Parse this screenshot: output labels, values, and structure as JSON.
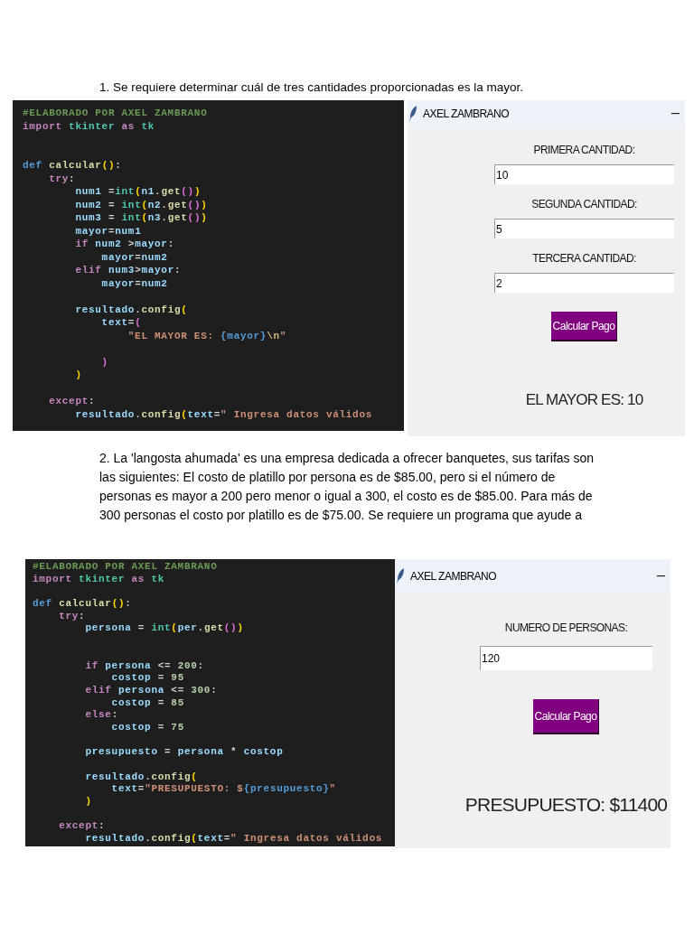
{
  "exercises": [
    {
      "statement": "1. Se requiere determinar cuál de tres cantidades proporcionadas es la mayor.",
      "code": {
        "lines": [
          {
            "kind": "code",
            "segments": [
              {
                "text": "#ELABORADO POR AXEL ZAMBRANO",
                "kind": "comment"
              }
            ]
          },
          {
            "kind": "code",
            "segments": [
              {
                "text": "import",
                "kind": "keyword"
              },
              {
                "text": " tkinter",
                "kind": "module"
              },
              {
                "text": " as ",
                "kind": "keyword"
              },
              {
                "text": "tk",
                "kind": "module"
              }
            ]
          },
          {
            "kind": "blank"
          },
          {
            "kind": "blank"
          },
          {
            "kind": "code",
            "segments": [
              {
                "text": "def ",
                "kind": "storage"
              },
              {
                "text": "calcular",
                "kind": "func"
              },
              {
                "text": "()",
                "kind": "bracket1"
              },
              {
                "text": ":",
                "kind": "op"
              }
            ]
          },
          {
            "kind": "code",
            "segments": [
              {
                "text": "    try",
                "kind": "keyword"
              },
              {
                "text": ":",
                "kind": "op"
              }
            ]
          },
          {
            "kind": "code",
            "segments": [
              {
                "text": "        num1",
                "kind": "var"
              },
              {
                "text": " =",
                "kind": "op"
              },
              {
                "text": "int",
                "kind": "builtin"
              },
              {
                "text": "(",
                "kind": "bracket1"
              },
              {
                "text": "n1",
                "kind": "var"
              },
              {
                "text": ".",
                "kind": "op"
              },
              {
                "text": "get",
                "kind": "func"
              },
              {
                "text": "()",
                "kind": "bracket2"
              },
              {
                "text": ")",
                "kind": "bracket1"
              }
            ]
          },
          {
            "kind": "code",
            "segments": [
              {
                "text": "        num2",
                "kind": "var"
              },
              {
                "text": " = ",
                "kind": "op"
              },
              {
                "text": "int",
                "kind": "builtin"
              },
              {
                "text": "(",
                "kind": "bracket1"
              },
              {
                "text": "n2",
                "kind": "var"
              },
              {
                "text": ".",
                "kind": "op"
              },
              {
                "text": "get",
                "kind": "func"
              },
              {
                "text": "()",
                "kind": "bracket2"
              },
              {
                "text": ")",
                "kind": "bracket1"
              }
            ]
          },
          {
            "kind": "code",
            "segments": [
              {
                "text": "        num3",
                "kind": "var"
              },
              {
                "text": " = ",
                "kind": "op"
              },
              {
                "text": "int",
                "kind": "builtin"
              },
              {
                "text": "(",
                "kind": "bracket1"
              },
              {
                "text": "n3",
                "kind": "var"
              },
              {
                "text": ".",
                "kind": "op"
              },
              {
                "text": "get",
                "kind": "func"
              },
              {
                "text": "()",
                "kind": "bracket2"
              },
              {
                "text": ")",
                "kind": "bracket1"
              }
            ]
          },
          {
            "kind": "code",
            "segments": [
              {
                "text": "        mayor",
                "kind": "var"
              },
              {
                "text": "=",
                "kind": "op"
              },
              {
                "text": "num1",
                "kind": "var"
              }
            ]
          },
          {
            "kind": "code",
            "segments": [
              {
                "text": "        if ",
                "kind": "keyword"
              },
              {
                "text": "num2",
                "kind": "var"
              },
              {
                "text": " >",
                "kind": "op"
              },
              {
                "text": "mayor",
                "kind": "var"
              },
              {
                "text": ":",
                "kind": "op"
              }
            ]
          },
          {
            "kind": "code",
            "segments": [
              {
                "text": "            mayor",
                "kind": "var"
              },
              {
                "text": "=",
                "kind": "op"
              },
              {
                "text": "num2",
                "kind": "var"
              }
            ]
          },
          {
            "kind": "code",
            "segments": [
              {
                "text": "        elif ",
                "kind": "keyword"
              },
              {
                "text": "num3",
                "kind": "var"
              },
              {
                "text": ">",
                "kind": "op"
              },
              {
                "text": "mayor",
                "kind": "var"
              },
              {
                "text": ":",
                "kind": "op"
              }
            ]
          },
          {
            "kind": "code",
            "segments": [
              {
                "text": "            mayor",
                "kind": "var"
              },
              {
                "text": "=",
                "kind": "op"
              },
              {
                "text": "num2",
                "kind": "var"
              }
            ]
          },
          {
            "kind": "blank"
          },
          {
            "kind": "code",
            "segments": [
              {
                "text": "        resultado",
                "kind": "var"
              },
              {
                "text": ".",
                "kind": "op"
              },
              {
                "text": "config",
                "kind": "func"
              },
              {
                "text": "(",
                "kind": "bracket1"
              }
            ]
          },
          {
            "kind": "code",
            "segments": [
              {
                "text": "            text",
                "kind": "var"
              },
              {
                "text": "=",
                "kind": "op"
              },
              {
                "text": "(",
                "kind": "bracket2"
              }
            ]
          },
          {
            "kind": "code",
            "segments": [
              {
                "text": "                \"EL MAYOR ES: ",
                "kind": "string"
              },
              {
                "text": "{mayor}",
                "kind": "format"
              },
              {
                "text": "\\n",
                "kind": "escape"
              },
              {
                "text": "\"",
                "kind": "string"
              }
            ]
          },
          {
            "kind": "blank"
          },
          {
            "kind": "code",
            "segments": [
              {
                "text": "            )",
                "kind": "bracket2"
              }
            ]
          },
          {
            "kind": "code",
            "segments": [
              {
                "text": "        )",
                "kind": "bracket1"
              }
            ]
          },
          {
            "kind": "blank"
          },
          {
            "kind": "code",
            "segments": [
              {
                "text": "    except",
                "kind": "keyword"
              },
              {
                "text": ":",
                "kind": "op"
              }
            ]
          },
          {
            "kind": "code",
            "segments": [
              {
                "text": "        resultado",
                "kind": "var"
              },
              {
                "text": ".",
                "kind": "op"
              },
              {
                "text": "config",
                "kind": "func"
              },
              {
                "text": "(",
                "kind": "bracket1"
              },
              {
                "text": "text",
                "kind": "var"
              },
              {
                "text": "=",
                "kind": "op"
              },
              {
                "text": "\" Ingresa datos válidos",
                "kind": "string"
              }
            ]
          }
        ]
      },
      "app": {
        "title": "AXEL ZAMBRANO",
        "fields": [
          {
            "label": "PRIMERA CANTIDAD:",
            "value": "10"
          },
          {
            "label": "SEGUNDA CANTIDAD:",
            "value": "5"
          },
          {
            "label": "TERCERA CANTIDAD:",
            "value": "2"
          }
        ],
        "button": "Calcular Pago",
        "result": "EL MAYOR ES: 10"
      }
    },
    {
      "statement": "2. La 'langosta ahumada' es una empresa dedicada a ofrecer banquetes, sus tarifas son las siguientes: El costo de platillo por persona es de $85.00, pero si el número de personas es mayor a 200 pero menor o igual a 300, el costo es de $85.00. Para más de 300 personas el costo por platillo es de $75.00. Se requiere un programa que ayude a",
      "code": {
        "lines": [
          {
            "kind": "code",
            "segments": [
              {
                "text": "#ELABORADO POR AXEL ZAMBRANO",
                "kind": "comment"
              }
            ]
          },
          {
            "kind": "code",
            "segments": [
              {
                "text": "import",
                "kind": "keyword"
              },
              {
                "text": " tkinter",
                "kind": "module"
              },
              {
                "text": " as ",
                "kind": "keyword"
              },
              {
                "text": "tk",
                "kind": "module"
              }
            ]
          },
          {
            "kind": "blank"
          },
          {
            "kind": "code",
            "segments": [
              {
                "text": "def ",
                "kind": "storage"
              },
              {
                "text": "calcular",
                "kind": "func"
              },
              {
                "text": "()",
                "kind": "bracket1"
              },
              {
                "text": ":",
                "kind": "op"
              }
            ]
          },
          {
            "kind": "code",
            "segments": [
              {
                "text": "    try",
                "kind": "keyword"
              },
              {
                "text": ":",
                "kind": "op"
              }
            ]
          },
          {
            "kind": "code",
            "segments": [
              {
                "text": "        persona",
                "kind": "var"
              },
              {
                "text": " = ",
                "kind": "op"
              },
              {
                "text": "int",
                "kind": "builtin"
              },
              {
                "text": "(",
                "kind": "bracket1"
              },
              {
                "text": "per",
                "kind": "var"
              },
              {
                "text": ".",
                "kind": "op"
              },
              {
                "text": "get",
                "kind": "func"
              },
              {
                "text": "()",
                "kind": "bracket2"
              },
              {
                "text": ")",
                "kind": "bracket1"
              }
            ]
          },
          {
            "kind": "blank"
          },
          {
            "kind": "blank"
          },
          {
            "kind": "code",
            "segments": [
              {
                "text": "        if ",
                "kind": "keyword"
              },
              {
                "text": "persona",
                "kind": "var"
              },
              {
                "text": " <= ",
                "kind": "op"
              },
              {
                "text": "200",
                "kind": "number"
              },
              {
                "text": ":",
                "kind": "op"
              }
            ]
          },
          {
            "kind": "code",
            "segments": [
              {
                "text": "            costop",
                "kind": "var"
              },
              {
                "text": " = ",
                "kind": "op"
              },
              {
                "text": "95",
                "kind": "number"
              }
            ]
          },
          {
            "kind": "code",
            "segments": [
              {
                "text": "        elif ",
                "kind": "keyword"
              },
              {
                "text": "persona",
                "kind": "var"
              },
              {
                "text": " <= ",
                "kind": "op"
              },
              {
                "text": "300",
                "kind": "number"
              },
              {
                "text": ":",
                "kind": "op"
              }
            ]
          },
          {
            "kind": "code",
            "segments": [
              {
                "text": "            costop",
                "kind": "var"
              },
              {
                "text": " = ",
                "kind": "op"
              },
              {
                "text": "85",
                "kind": "number"
              }
            ]
          },
          {
            "kind": "code",
            "segments": [
              {
                "text": "        else",
                "kind": "keyword"
              },
              {
                "text": ":",
                "kind": "op"
              }
            ]
          },
          {
            "kind": "code",
            "segments": [
              {
                "text": "            costop",
                "kind": "var"
              },
              {
                "text": " = ",
                "kind": "op"
              },
              {
                "text": "75",
                "kind": "number"
              }
            ]
          },
          {
            "kind": "blank"
          },
          {
            "kind": "code",
            "segments": [
              {
                "text": "        presupuesto",
                "kind": "var"
              },
              {
                "text": " = ",
                "kind": "op"
              },
              {
                "text": "persona",
                "kind": "var"
              },
              {
                "text": " * ",
                "kind": "op"
              },
              {
                "text": "costop",
                "kind": "var"
              }
            ]
          },
          {
            "kind": "blank"
          },
          {
            "kind": "code",
            "segments": [
              {
                "text": "        resultado",
                "kind": "var"
              },
              {
                "text": ".",
                "kind": "op"
              },
              {
                "text": "config",
                "kind": "func"
              },
              {
                "text": "(",
                "kind": "bracket1"
              }
            ]
          },
          {
            "kind": "code",
            "segments": [
              {
                "text": "            text",
                "kind": "var"
              },
              {
                "text": "=",
                "kind": "op"
              },
              {
                "text": "\"PRESUPUESTO: $",
                "kind": "string"
              },
              {
                "text": "{presupuesto}",
                "kind": "format"
              },
              {
                "text": "\"",
                "kind": "string"
              }
            ]
          },
          {
            "kind": "code",
            "segments": [
              {
                "text": "        )",
                "kind": "bracket1"
              }
            ]
          },
          {
            "kind": "blank"
          },
          {
            "kind": "code",
            "segments": [
              {
                "text": "    except",
                "kind": "keyword"
              },
              {
                "text": ":",
                "kind": "op"
              }
            ]
          },
          {
            "kind": "code",
            "segments": [
              {
                "text": "        resultado",
                "kind": "var"
              },
              {
                "text": ".",
                "kind": "op"
              },
              {
                "text": "config",
                "kind": "func"
              },
              {
                "text": "(",
                "kind": "bracket1"
              },
              {
                "text": "text",
                "kind": "var"
              },
              {
                "text": "=",
                "kind": "op"
              },
              {
                "text": "\" Ingresa datos válidos",
                "kind": "string"
              }
            ]
          }
        ]
      },
      "app": {
        "title": "AXEL ZAMBRANO",
        "fields": [
          {
            "label": "NUMERO DE PERSONAS:",
            "value": "120"
          }
        ],
        "button": "Calcular Pago",
        "result": "PRESUPUESTO: $11400"
      }
    }
  ]
}
